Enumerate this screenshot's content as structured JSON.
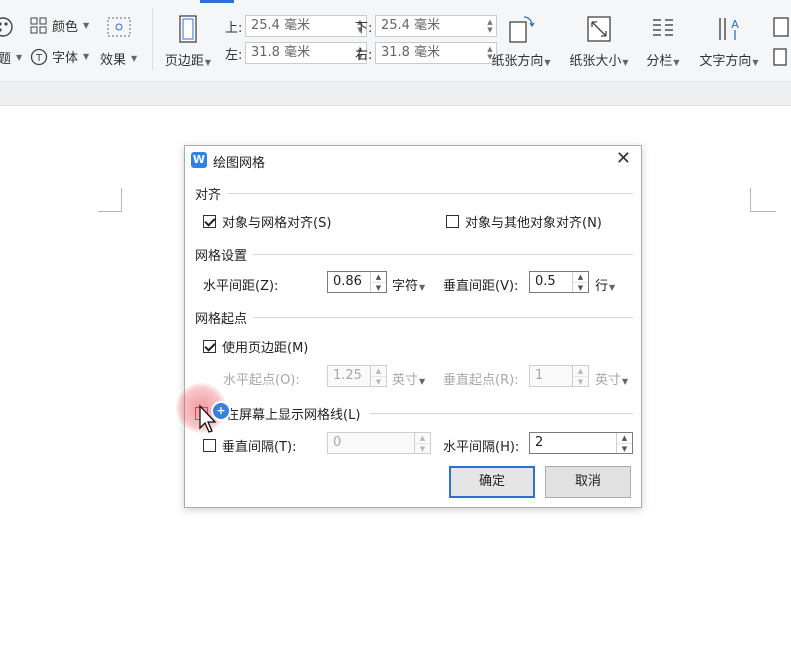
{
  "ribbon": {
    "color_label": "颜色",
    "font_label": "字体",
    "effect_label": "效果",
    "partial_left_label": "题",
    "margins_label": "页边距",
    "margin_top_label": "上:",
    "margin_top_value": "25.4 毫米",
    "margin_bottom_label": "下:",
    "margin_bottom_value": "25.4 毫米",
    "margin_left_label": "左:",
    "margin_left_value": "31.8 毫米",
    "margin_right_label": "右:",
    "margin_right_value": "31.8 毫米",
    "orientation_label": "纸张方向",
    "size_label": "纸张大小",
    "columns_label": "分栏",
    "text_direction_label": "文字方向"
  },
  "dialog": {
    "title": "绘图网格",
    "app_icon_text": "W",
    "align_group": "对齐",
    "snap_to_grid_label": "对象与网格对齐(S)",
    "snap_to_grid_checked": true,
    "snap_to_objects_label": "对象与其他对象对齐(N)",
    "snap_to_objects_checked": false,
    "grid_settings_group": "网格设置",
    "horizontal_spacing_label": "水平间距(Z):",
    "horizontal_spacing_value": "0.86",
    "horizontal_spacing_unit": "字符",
    "vertical_spacing_label": "垂直间距(V):",
    "vertical_spacing_value": "0.5",
    "vertical_spacing_unit": "行",
    "grid_origin_group": "网格起点",
    "use_margins_label": "使用页边距(M)",
    "use_margins_checked": true,
    "horizontal_origin_label": "水平起点(O):",
    "horizontal_origin_value": "1.25",
    "horizontal_origin_unit": "英寸",
    "vertical_origin_label": "垂直起点(R):",
    "vertical_origin_value": "1",
    "vertical_origin_unit": "英寸",
    "show_gridlines_label": "在屏幕上显示网格线(L)",
    "show_gridlines_checked": false,
    "vertical_interval_label": "垂直间隔(T):",
    "vertical_interval_value": "0",
    "vertical_interval_checked": false,
    "horizontal_interval_label": "水平间隔(H):",
    "horizontal_interval_value": "2",
    "ok_label": "确定",
    "cancel_label": "取消"
  },
  "colors": {
    "accent": "#2f6fcf",
    "click_highlight": "#eb4650"
  },
  "icons": [
    "theme-icon",
    "color-icon",
    "font-icon",
    "effect-icon",
    "margins-icon",
    "orientation-icon",
    "size-icon",
    "columns-icon",
    "text-direction-icon",
    "close-icon",
    "checkbox-icon",
    "cursor-icon"
  ]
}
